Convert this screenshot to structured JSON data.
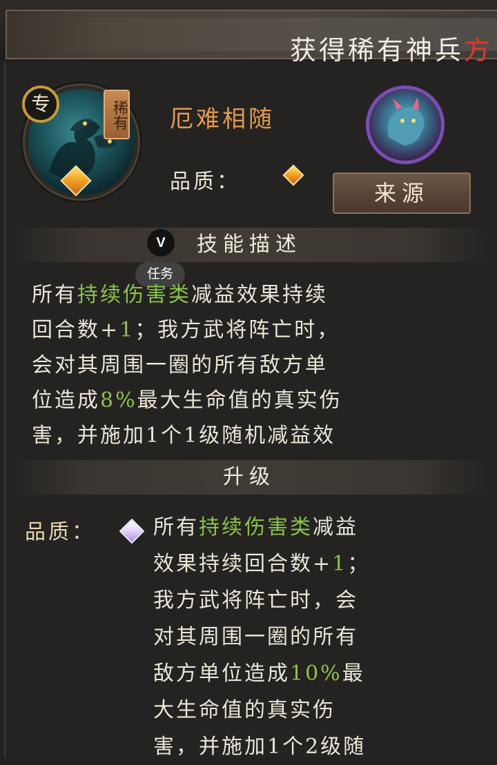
{
  "banner": {
    "text_prefix": "获得稀有神兵",
    "text_highlight": "方"
  },
  "skill": {
    "badge": "专",
    "rarity": "稀有",
    "name": "厄难相随",
    "quality_label": "品质：",
    "source_button": "来源",
    "gem_icon": "orange-diamond-gem-icon"
  },
  "section_titles": {
    "description": "技能描述",
    "upgrade": "升级"
  },
  "overlay": {
    "v_label": "V",
    "task_label": "任务"
  },
  "description_lines": [
    [
      {
        "t": "所有"
      },
      {
        "t": "持续伤害类",
        "hl": true
      },
      {
        "t": "减益效果持续"
      }
    ],
    [
      {
        "t": "回合数+"
      },
      {
        "t": "1",
        "hl": true
      },
      {
        "t": "；我方武将阵亡时，"
      }
    ],
    [
      {
        "t": "会对其周围一圈的所有敌方单"
      }
    ],
    [
      {
        "t": "位造成"
      },
      {
        "t": "8%",
        "hl": true
      },
      {
        "t": "最大生命值的真实伤"
      }
    ],
    [
      {
        "t": "害，并施加1个1级随机减益效"
      }
    ]
  ],
  "upgrade": {
    "quality_label": "品质：",
    "gem_icon": "purple-diamond-gem-icon",
    "lines": [
      [
        {
          "t": "所有"
        },
        {
          "t": "持续伤害类",
          "hl": true
        },
        {
          "t": "减益"
        }
      ],
      [
        {
          "t": "效果持续回合数+"
        },
        {
          "t": "1",
          "hl": true
        },
        {
          "t": "；"
        }
      ],
      [
        {
          "t": "我方武将阵亡时，会"
        }
      ],
      [
        {
          "t": "对其周围一圈的所有"
        }
      ],
      [
        {
          "t": "敌方单位造成"
        },
        {
          "t": "10%",
          "hl": true
        },
        {
          "t": "最"
        }
      ],
      [
        {
          "t": "大生命值的真实伤"
        }
      ],
      [
        {
          "t": "害，并施加1个2级随"
        }
      ]
    ]
  },
  "colors": {
    "highlight_green": "#8bc34a",
    "skill_name_orange": "#e39a4e",
    "banner_red": "#e0392b"
  }
}
